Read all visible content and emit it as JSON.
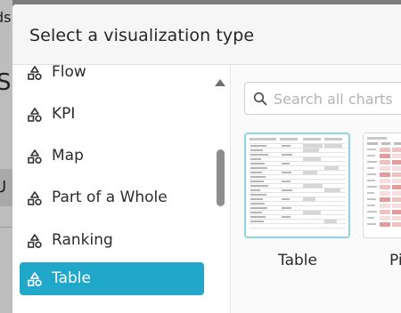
{
  "background": {
    "partial_texts": [
      "ds",
      "S",
      "U"
    ]
  },
  "modal": {
    "title": "Select a visualization type"
  },
  "categories": [
    {
      "label": "Flow",
      "icon": "shapes-icon",
      "active": false
    },
    {
      "label": "KPI",
      "icon": "shapes-icon",
      "active": false
    },
    {
      "label": "Map",
      "icon": "shapes-icon",
      "active": false
    },
    {
      "label": "Part of a Whole",
      "icon": "shapes-icon",
      "active": false
    },
    {
      "label": "Ranking",
      "icon": "shapes-icon",
      "active": false
    },
    {
      "label": "Table",
      "icon": "shapes-icon",
      "active": true
    }
  ],
  "search": {
    "placeholder": "Search all charts",
    "value": ""
  },
  "charts": [
    {
      "label": "Table",
      "selected": true
    },
    {
      "label": "Pivot",
      "selected": false
    }
  ],
  "colors": {
    "accent": "#20a7c9",
    "selected_border": "#8fd3e2",
    "header_bg": "#f6f6f6",
    "overlay": "#7d7d7d"
  }
}
